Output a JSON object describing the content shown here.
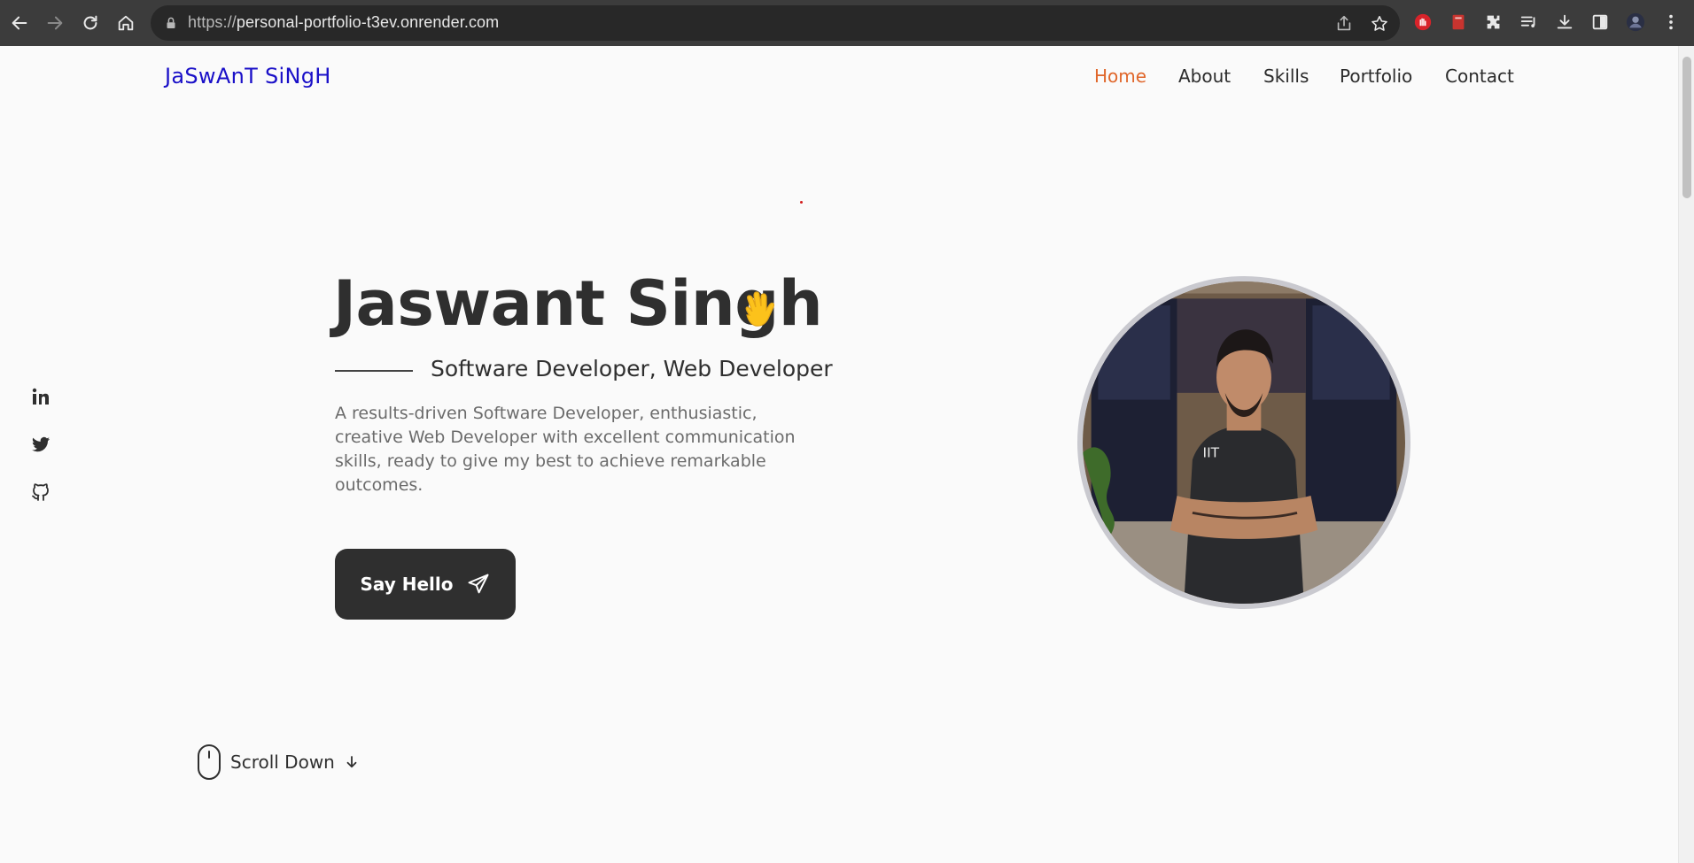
{
  "browser": {
    "url_prefix": "https://",
    "url_host": "personal-portfolio-t3ev.onrender.com"
  },
  "nav": {
    "logo": "JaSwAnT SiNgH",
    "items": [
      {
        "label": "Home",
        "active": true
      },
      {
        "label": "About",
        "active": false
      },
      {
        "label": "Skills",
        "active": false
      },
      {
        "label": "Portfolio",
        "active": false
      },
      {
        "label": "Contact",
        "active": false
      }
    ]
  },
  "social": [
    "linkedin-icon",
    "twitter-icon",
    "github-icon"
  ],
  "hero": {
    "name": "Jaswant Singh",
    "subtitle": "Software Developer, Web Developer",
    "description": "A results-driven Software Developer, enthusiastic, creative Web Developer with excellent communication skills, ready to give my best to achieve remarkable outcomes.",
    "button_label": "Say Hello"
  },
  "scroll": {
    "label": "Scroll Down"
  },
  "colors": {
    "logo": "#1a10c8",
    "active_nav": "#e0662a",
    "dark": "#2f2f2f",
    "background": "#fafafa"
  }
}
